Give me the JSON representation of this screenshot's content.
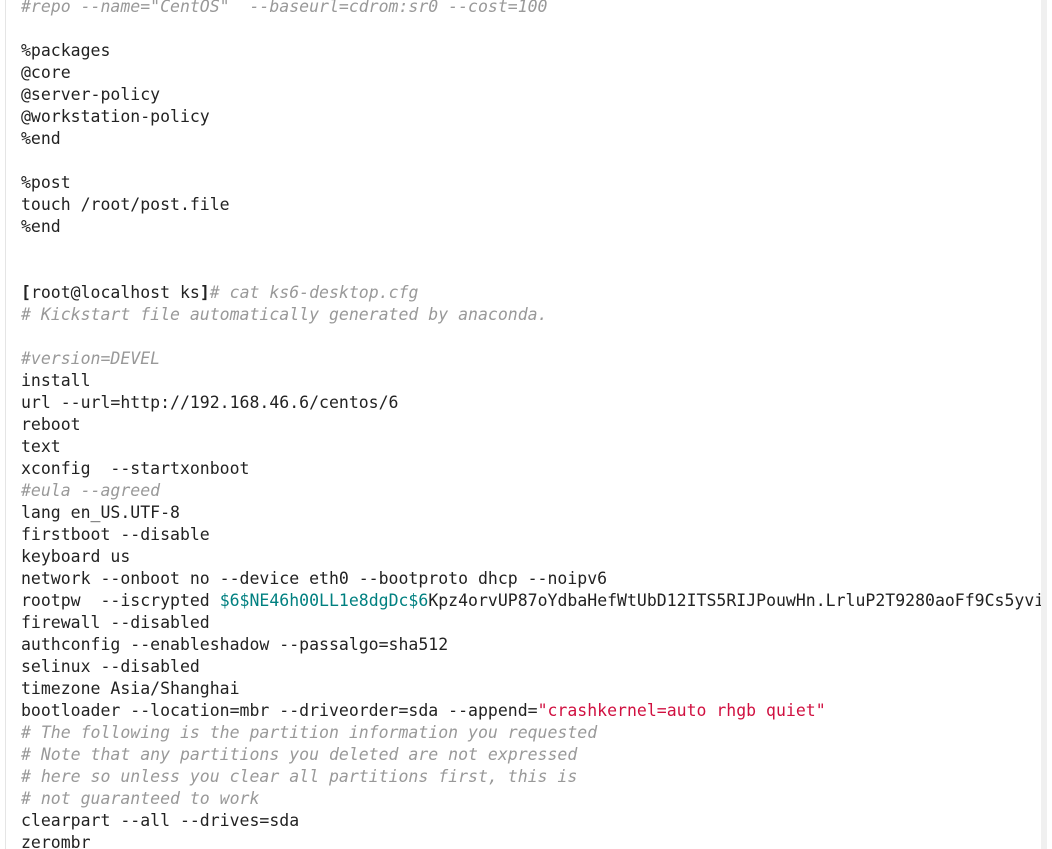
{
  "colors": {
    "comment": "#999999",
    "variable": "#008080",
    "string": "#d01040",
    "text": "#222222"
  },
  "lines": [
    [
      {
        "t": "#repo --name=\"CentOS\"  --baseurl=cdrom:sr0 --cost=100",
        "c": "cm"
      }
    ],
    [],
    [
      {
        "t": "%packages",
        "c": ""
      }
    ],
    [
      {
        "t": "@core",
        "c": ""
      }
    ],
    [
      {
        "t": "@server-policy",
        "c": ""
      }
    ],
    [
      {
        "t": "@workstation-policy",
        "c": ""
      }
    ],
    [
      {
        "t": "%end",
        "c": ""
      }
    ],
    [],
    [
      {
        "t": "%post",
        "c": ""
      }
    ],
    [
      {
        "t": "touch /root/post.file",
        "c": ""
      }
    ],
    [
      {
        "t": "%end",
        "c": ""
      }
    ],
    [],
    [],
    [
      {
        "t": "[",
        "c": "b"
      },
      {
        "t": "root@localhost ks",
        "c": ""
      },
      {
        "t": "]",
        "c": "b"
      },
      {
        "t": "# cat ks6-desktop.cfg",
        "c": "cm"
      }
    ],
    [
      {
        "t": "# Kickstart file automatically generated by anaconda.",
        "c": "cm"
      }
    ],
    [],
    [
      {
        "t": "#version=DEVEL",
        "c": "cm"
      }
    ],
    [
      {
        "t": "install",
        "c": ""
      }
    ],
    [
      {
        "t": "url --url=http://192.168.46.6/centos/6",
        "c": ""
      }
    ],
    [
      {
        "t": "reboot",
        "c": ""
      }
    ],
    [
      {
        "t": "text",
        "c": ""
      }
    ],
    [
      {
        "t": "xconfig  --startxonboot",
        "c": ""
      }
    ],
    [
      {
        "t": "#eula --agreed",
        "c": "cm"
      }
    ],
    [
      {
        "t": "lang en_US.UTF-8",
        "c": ""
      }
    ],
    [
      {
        "t": "firstboot --disable",
        "c": ""
      }
    ],
    [
      {
        "t": "keyboard us",
        "c": ""
      }
    ],
    [
      {
        "t": "network --onboot no --device eth0 --bootproto dhcp --noipv6",
        "c": ""
      }
    ],
    [
      {
        "t": "rootpw  --iscrypted ",
        "c": ""
      },
      {
        "t": "$6$NE46h00LL1e8dgDc$6",
        "c": "var"
      },
      {
        "t": "Kpz4orvUP87oYdbaHefWtUbD12ITS5RIJPouwHn.LrluP2T9280aoFf9Cs5yvi",
        "c": ""
      }
    ],
    [
      {
        "t": "firewall --disabled",
        "c": ""
      }
    ],
    [
      {
        "t": "authconfig --enableshadow --passalgo=sha512",
        "c": ""
      }
    ],
    [
      {
        "t": "selinux --disabled",
        "c": ""
      }
    ],
    [
      {
        "t": "timezone Asia/Shanghai",
        "c": ""
      }
    ],
    [
      {
        "t": "bootloader --location=mbr --driveorder=sda --append=",
        "c": ""
      },
      {
        "t": "\"crashkernel=auto rhgb quiet\"",
        "c": "str"
      }
    ],
    [
      {
        "t": "# The following is the partition information you requested",
        "c": "cm"
      }
    ],
    [
      {
        "t": "# Note that any partitions you deleted are not expressed",
        "c": "cm"
      }
    ],
    [
      {
        "t": "# here so unless you clear all partitions first, this is",
        "c": "cm"
      }
    ],
    [
      {
        "t": "# not guaranteed to work",
        "c": "cm"
      }
    ],
    [
      {
        "t": "clearpart --all --drives=sda",
        "c": ""
      }
    ],
    [
      {
        "t": "zerombr",
        "c": ""
      }
    ]
  ]
}
